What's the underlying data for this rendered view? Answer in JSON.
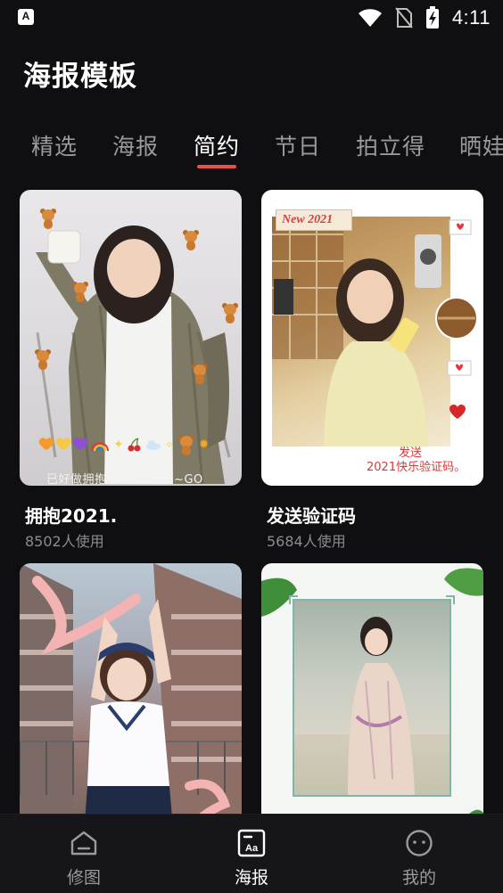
{
  "status_bar": {
    "app_icon_letter": "A",
    "time": "4:11",
    "icons": [
      "wifi-icon",
      "no-sim-icon",
      "battery-charging-icon"
    ]
  },
  "header": {
    "title": "海报模板"
  },
  "tabs": [
    {
      "label": "精选",
      "active": false
    },
    {
      "label": "海报",
      "active": false
    },
    {
      "label": "简约",
      "active": true
    },
    {
      "label": "节日",
      "active": false
    },
    {
      "label": "拍立得",
      "active": false
    },
    {
      "label": "晒娃",
      "active": false
    }
  ],
  "templates": [
    {
      "name": "拥抱2021.",
      "usage": "8502人使用",
      "caption": "已好做拥抱2021的准备~GO"
    },
    {
      "name": "发送验证码",
      "usage": "5684人使用",
      "caption_line1": "发送",
      "caption_line2": "2021快乐验证码。",
      "badge": "New 2021"
    },
    {
      "name": "",
      "usage": ""
    },
    {
      "name": "",
      "usage": ""
    }
  ],
  "bottom_nav": [
    {
      "label": "修图",
      "icon": "home-icon",
      "active": false
    },
    {
      "label": "海报",
      "icon": "poster-aa-icon",
      "active": true
    },
    {
      "label": "我的",
      "icon": "face-icon",
      "active": false
    }
  ]
}
